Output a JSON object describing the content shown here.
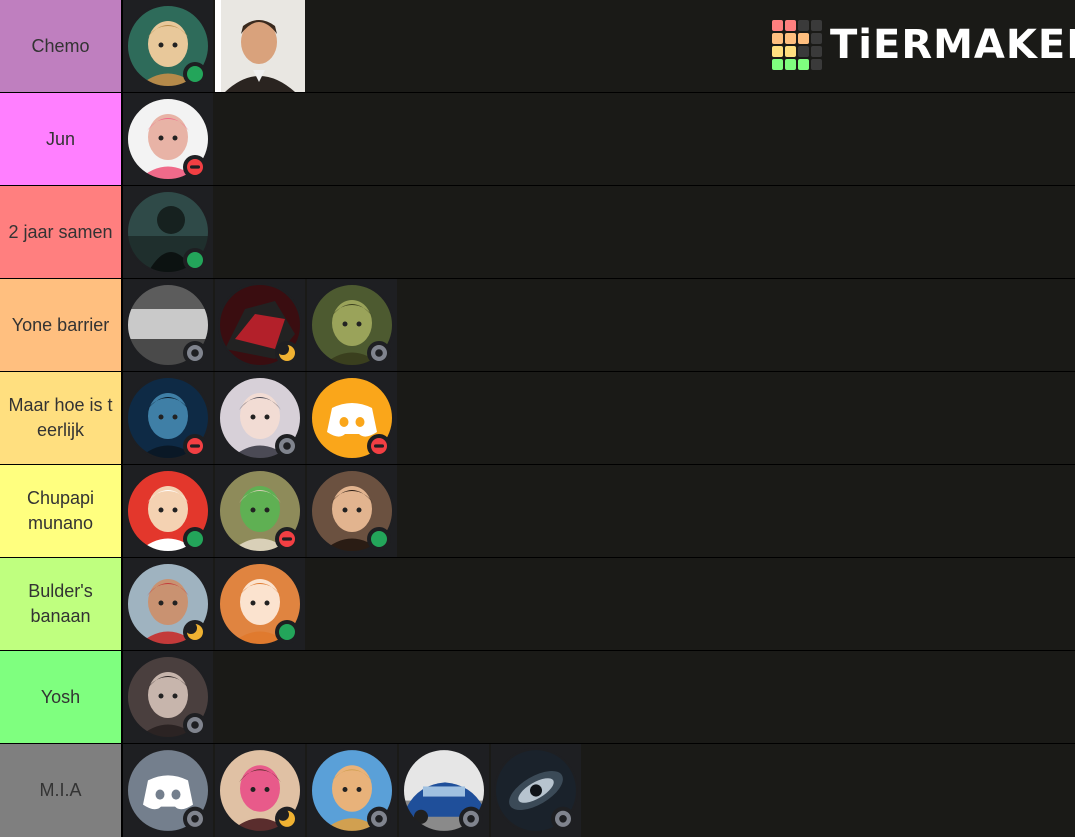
{
  "brand": {
    "logo_text": "TiERMAKER",
    "logo_colors": [
      "#ff7f7f",
      "#ffbf7f",
      "#ffdf7f",
      "#bfff7f",
      "#7fff7f"
    ]
  },
  "tiers": [
    {
      "label": "Chemo",
      "color": "#bf7fbf",
      "items": [
        {
          "icon": "elf-anime-avatar",
          "status": "online"
        },
        {
          "icon": "man-portrait-photo",
          "status": "none"
        }
      ]
    },
    {
      "label": "Jun",
      "color": "#ff7fff",
      "items": [
        {
          "icon": "bald-man-worm-avatar",
          "status": "dnd"
        }
      ]
    },
    {
      "label": "2 jaar samen",
      "color": "#ff7f7f",
      "items": [
        {
          "icon": "dark-silhouette-avatar",
          "status": "online"
        }
      ]
    },
    {
      "label": "Yone barrier",
      "color": "#ffbf7f",
      "items": [
        {
          "icon": "yu-gi-wa-text-avatar",
          "status": "offline"
        },
        {
          "icon": "red-robot-avatar",
          "status": "idle"
        },
        {
          "icon": "lizard-avatar",
          "status": "offline"
        }
      ]
    },
    {
      "label": "Maar hoe is t eerlijk",
      "color": "#ffdf7f",
      "items": [
        {
          "icon": "blue-creature-avatar",
          "status": "dnd"
        },
        {
          "icon": "anime-girl-avatar",
          "status": "offline"
        },
        {
          "icon": "discord-orange-avatar",
          "status": "dnd"
        }
      ]
    },
    {
      "label": "Chupapi munano",
      "color": "#ffff7f",
      "items": [
        {
          "icon": "chef-honk-avatar",
          "status": "online"
        },
        {
          "icon": "green-hat-character-avatar",
          "status": "dnd"
        },
        {
          "icon": "two-men-avatar",
          "status": "online"
        }
      ]
    },
    {
      "label": "Bulder's banaan",
      "color": "#bfff7f",
      "items": [
        {
          "icon": "man-street-photo-avatar",
          "status": "idle"
        },
        {
          "icon": "orange-hair-anime-avatar",
          "status": "online"
        }
      ]
    },
    {
      "label": "Yosh",
      "color": "#7fff7f",
      "items": [
        {
          "icon": "dark-anime-boy-avatar",
          "status": "offline"
        }
      ]
    },
    {
      "label": "M.I.A",
      "color": "#7f7f7f",
      "items": [
        {
          "icon": "discord-grey-avatar",
          "status": "offline"
        },
        {
          "icon": "pink-fox-avatar",
          "status": "idle"
        },
        {
          "icon": "sombrero-avatar",
          "status": "offline"
        },
        {
          "icon": "blue-car-avatar",
          "status": "offline"
        },
        {
          "icon": "galaxy-avatar",
          "status": "offline"
        }
      ]
    }
  ]
}
